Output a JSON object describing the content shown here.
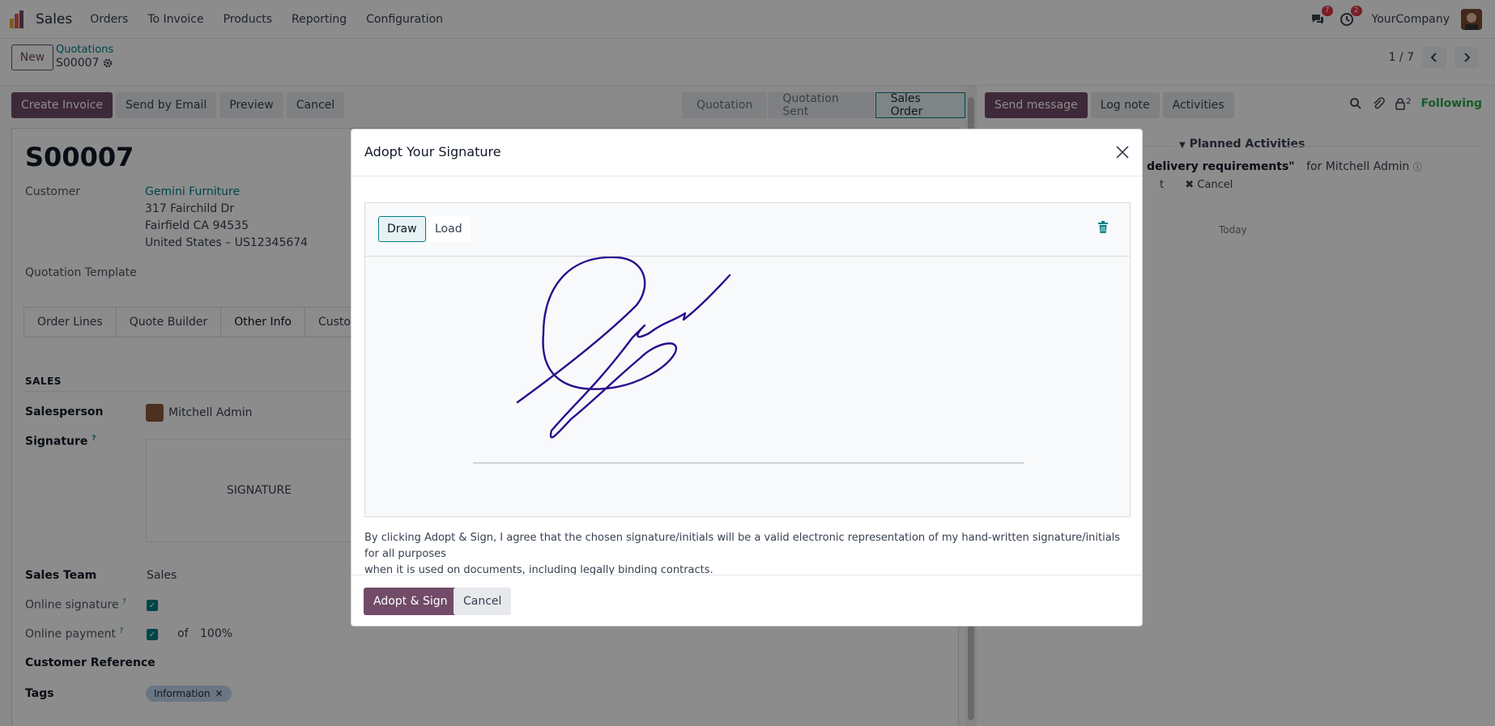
{
  "navbar": {
    "app_name": "Sales",
    "menu": [
      "Orders",
      "To Invoice",
      "Products",
      "Reporting",
      "Configuration"
    ],
    "messages_count": "7",
    "activities_count": "2",
    "company": "YourCompany"
  },
  "control": {
    "new_label": "New",
    "breadcrumb_parent": "Quotations",
    "breadcrumb_current": "S00007",
    "pager": "1 / 7"
  },
  "actions": {
    "create_invoice": "Create Invoice",
    "send_email": "Send by Email",
    "preview": "Preview",
    "cancel": "Cancel"
  },
  "status": {
    "steps": [
      "Quotation",
      "Quotation Sent",
      "Sales Order"
    ],
    "active": "Sales Order"
  },
  "form": {
    "name": "S00007",
    "customer_label": "Customer",
    "customer_name": "Gemini Furniture",
    "address1": "317 Fairchild Dr",
    "address2": "Fairfield CA 94535",
    "address3": "United States – US12345674",
    "template_label": "Quotation Template",
    "tabs": [
      "Order Lines",
      "Quote Builder",
      "Other Info",
      "Custome"
    ],
    "section_sales": "SALES",
    "salesperson_label": "Salesperson",
    "salesperson_value": "Mitchell Admin",
    "signature_label": "Signature",
    "signature_placeholder": "SIGNATURE",
    "sales_team_label": "Sales Team",
    "sales_team_value": "Sales",
    "online_signature_label": "Online signature",
    "online_payment_label": "Online payment",
    "payment_of": "of",
    "payment_percent": "100%",
    "customer_ref_label": "Customer Reference",
    "tags_label": "Tags",
    "tag_value": "Information",
    "help_mark": "?"
  },
  "chatter": {
    "send_message": "Send message",
    "log_note": "Log note",
    "activities": "Activities",
    "followers_count": "2",
    "following": "Following",
    "planned_activities": "Planned Activities",
    "activity_title": "delivery requirements\"",
    "activity_for": "for Mitchell Admin",
    "activity_left_fragment": "t",
    "activity_cancel": "Cancel",
    "today": "Today"
  },
  "dialog": {
    "title": "Adopt Your Signature",
    "draw_label": "Draw",
    "load_label": "Load",
    "disclaimer_line1": "By clicking Adopt & Sign, I agree that the chosen signature/initials will be a valid electronic representation of my hand-written signature/initials for all purposes",
    "disclaimer_line2": "when it is used on documents, including legally binding contracts.",
    "adopt_label": "Adopt & Sign",
    "cancel_label": "Cancel"
  },
  "colors": {
    "primary": "#714b67",
    "teal": "#017e84",
    "signature_ink": "#2a0a8c",
    "following": "#28a745",
    "badge": "#dc3545"
  }
}
